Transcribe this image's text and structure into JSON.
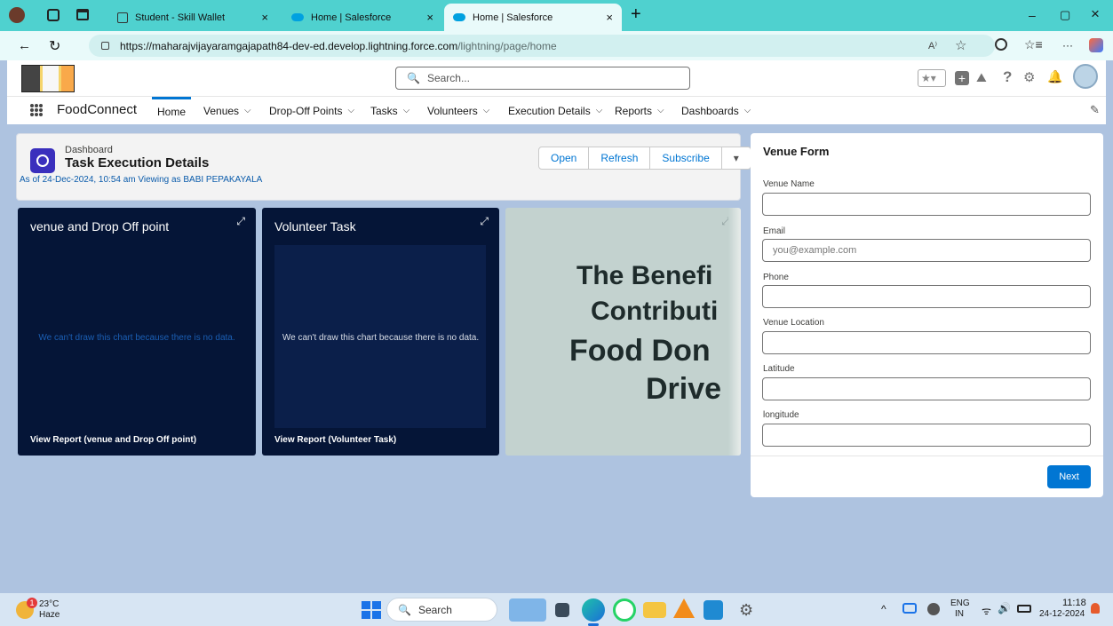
{
  "browser": {
    "tabs": [
      {
        "title": "Student - Skill Wallet",
        "active": false
      },
      {
        "title": "Home | Salesforce",
        "active": false
      },
      {
        "title": "Home | Salesforce",
        "active": true
      }
    ],
    "close_glyph": "×",
    "new_tab_glyph": "+",
    "url_host": "https://maharajvijayaramgajapath84-dev-ed.develop.lightning.force.com",
    "url_path": "/lightning/page/home",
    "min_glyph": "–",
    "max_glyph": "▢",
    "win_close_glyph": "×",
    "more_glyph": "···",
    "reader_glyph": "A⁾"
  },
  "salesforce": {
    "search_placeholder": "Search...",
    "app_name": "FoodConnect",
    "help_glyph": "?",
    "nav": [
      {
        "label": "Home",
        "dropdown": false,
        "active": true
      },
      {
        "label": "Venues",
        "dropdown": true
      },
      {
        "label": "Drop-Off Points",
        "dropdown": true
      },
      {
        "label": "Tasks",
        "dropdown": true
      },
      {
        "label": "Volunteers",
        "dropdown": true
      },
      {
        "label": "Execution Details",
        "dropdown": true
      },
      {
        "label": "Reports",
        "dropdown": true
      },
      {
        "label": "Dashboards",
        "dropdown": true
      }
    ],
    "chevron": "⌵"
  },
  "dashboard": {
    "eyebrow": "Dashboard",
    "title": "Task Execution Details",
    "subtitle": "As of 24-Dec-2024, 10:54 am Viewing as BABI PEPAKAYALA",
    "buttons": {
      "open": "Open",
      "refresh": "Refresh",
      "subscribe": "Subscribe",
      "menu": "▾"
    },
    "tiles": [
      {
        "title": "venue and Drop Off point",
        "message": "We can't draw this chart because there is no data.",
        "link": "View Report (venue and Drop Off point)"
      },
      {
        "title": "Volunteer Task",
        "message": "We can't draw this chart because there is no data.",
        "link": "View Report (Volunteer Task)"
      }
    ],
    "image_tile_lines": [
      "The Benefi",
      "Contributi",
      "Food Don",
      "Drive"
    ]
  },
  "form": {
    "title": "Venue Form",
    "fields": [
      {
        "label": "Venue Name",
        "value": "",
        "placeholder": ""
      },
      {
        "label": "Email",
        "value": "",
        "placeholder": "you@example.com"
      },
      {
        "label": "Phone",
        "value": "",
        "placeholder": ""
      },
      {
        "label": "Venue Location",
        "value": "",
        "placeholder": ""
      },
      {
        "label": "Latitude",
        "value": "",
        "placeholder": ""
      },
      {
        "label": "longitude",
        "value": "",
        "placeholder": ""
      }
    ],
    "next_label": "Next"
  },
  "taskbar": {
    "weather_temp": "23°C",
    "weather_desc": "Haze",
    "weather_badge": "1",
    "search_label": "Search",
    "lang_top": "ENG",
    "lang_bottom": "IN",
    "time": "11:18",
    "date": "24-12-2024",
    "caret": "^"
  },
  "colors": {
    "accent": "#0176d3",
    "tab_bar": "#4fd1cf",
    "tile_dark": "#051537",
    "page_bg": "#aec3e0",
    "dashboard_icon": "#3a2fbd"
  }
}
